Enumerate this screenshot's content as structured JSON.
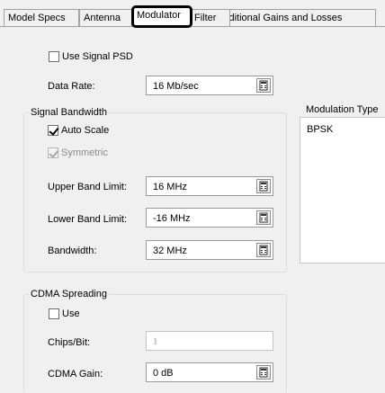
{
  "tabs": [
    {
      "label": "Model Specs",
      "active": false
    },
    {
      "label": "Antenna",
      "active": false
    },
    {
      "label": "Modulator",
      "active": true
    },
    {
      "label": "Filter",
      "active": false
    },
    {
      "label": "Additional Gains and Losses",
      "active": false
    }
  ],
  "signal_psd": {
    "label": "Use Signal PSD",
    "checked": false
  },
  "data_rate": {
    "label": "Data Rate:",
    "value": "16 Mb/sec"
  },
  "signal_bandwidth": {
    "title": "Signal Bandwidth",
    "auto_scale": {
      "label": "Auto Scale",
      "checked": true
    },
    "symmetric": {
      "label": "Symmetric",
      "checked": true,
      "disabled": true
    },
    "upper": {
      "label": "Upper Band Limit:",
      "value": "16 MHz"
    },
    "lower": {
      "label": "Lower Band Limit:",
      "value": "-16 MHz"
    },
    "bandwidth": {
      "label": "Bandwidth:",
      "value": "32 MHz"
    }
  },
  "modulation": {
    "title": "Modulation Type",
    "selected": "BPSK"
  },
  "cdma": {
    "title": "CDMA Spreading",
    "use": {
      "label": "Use",
      "checked": false
    },
    "chips_per_bit": {
      "label": "Chips/Bit:",
      "value": "1"
    },
    "gain": {
      "label": "CDMA Gain:",
      "value": "0 dB"
    }
  },
  "icons": {
    "unit_button": "calculator-icon"
  }
}
